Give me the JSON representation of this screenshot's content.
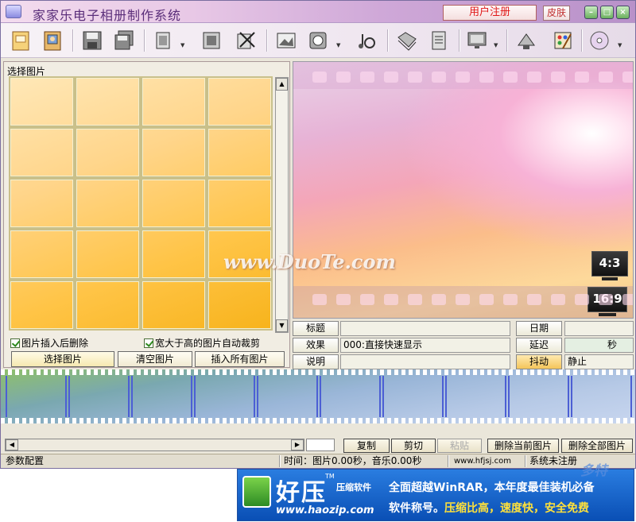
{
  "window": {
    "title": "家家乐电子相册制作系统",
    "register_label": "用户注册",
    "skin_label": "皮肤",
    "minimize_glyph": "–",
    "maximize_glyph": "□",
    "close_glyph": "×"
  },
  "toolbar": {
    "icons": [
      "notebook-icon",
      "photo-album-icon",
      "save-icon",
      "save-all-icon",
      "page-layout-icon",
      "photo-frame-icon",
      "scissors-icon",
      "edit-image-icon",
      "effects-icon",
      "music-note-icon",
      "folder-icon",
      "document-icon",
      "monitor-icon",
      "tools-icon",
      "palette-icon",
      "cd-disc-icon"
    ]
  },
  "left_panel": {
    "label": "选择图片",
    "checkbox_delete_after_insert": "图片插入后删除",
    "checkbox_auto_crop": "宽大于高的图片自动裁剪",
    "btn_select": "选择图片",
    "btn_clear": "清空图片",
    "btn_insert_all": "插入所有图片"
  },
  "preview": {
    "watermark": "www.DuoTe.com",
    "ratio_4_3": "4:3",
    "ratio_16_9": "16:9"
  },
  "fields": {
    "title_label": "标题",
    "title_value": "",
    "effect_label": "效果",
    "effect_value": "000:直接快速显示",
    "desc_label": "说明",
    "desc_value": "",
    "date_label": "日期",
    "date_value": "",
    "delay_label": "延迟",
    "delay_unit": "秒",
    "shake_label": "抖动",
    "shake_value": "静止"
  },
  "bottom_buttons": {
    "copy": "复制",
    "cut": "剪切",
    "paste": "粘贴",
    "delete_current": "删除当前图片",
    "delete_all": "删除全部图片"
  },
  "statusbar": {
    "left": "参数配置",
    "time": "时间：图片0.00秒，音乐0.00秒",
    "url": "www.hfjsj.com",
    "status": "系统未注册"
  },
  "ad": {
    "brand": "好压",
    "tm": "TM",
    "sub": "压缩软件",
    "url": "www.haozip.com",
    "line1": "全面超越WinRAR，本年度最佳装机必备",
    "line2_a": "软件称号。",
    "line2_b": "压缩比高，速度快，安全免费"
  },
  "site_mark": "多特"
}
